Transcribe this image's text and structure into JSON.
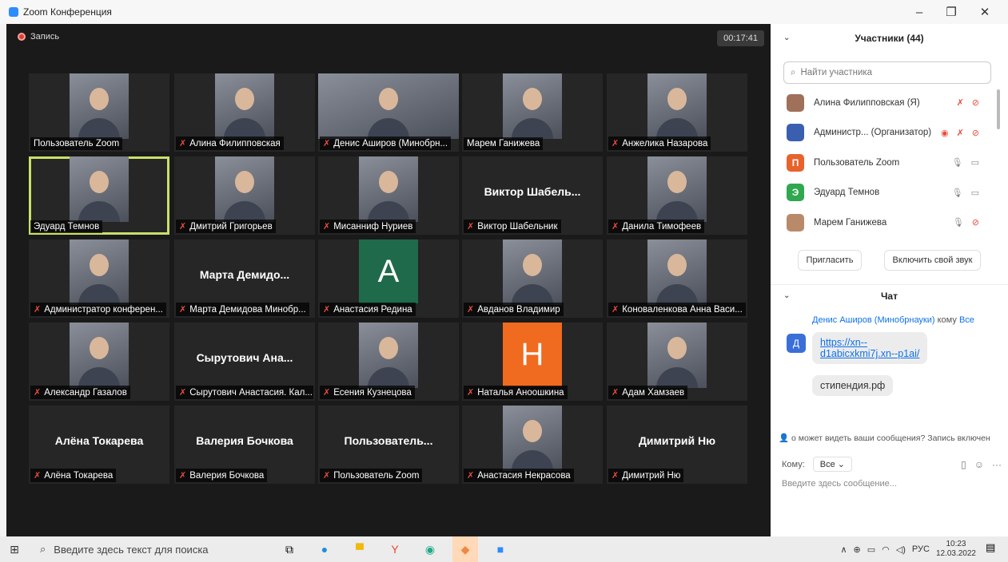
{
  "window": {
    "title": "Zoom Конференция",
    "minimize": "–",
    "restore": "❐",
    "close": "✕"
  },
  "meeting": {
    "recording_label": "Запись",
    "timer": "00:17:41"
  },
  "tiles": [
    {
      "label": "Пользователь Zoom",
      "muted": false,
      "kind": "photo"
    },
    {
      "label": "Алина Филипповская",
      "muted": true,
      "kind": "photo"
    },
    {
      "label": "Денис Аширов (Минобрн...",
      "muted": true,
      "kind": "photo-wide"
    },
    {
      "label": "Марем Ганижева",
      "muted": false,
      "kind": "photo"
    },
    {
      "label": "Анжелика Назарова",
      "muted": true,
      "kind": "photo"
    },
    {
      "label": "Эдуард Темнов",
      "muted": false,
      "kind": "photo",
      "active": true
    },
    {
      "label": "Дмитрий Григорьев",
      "muted": true,
      "kind": "photo"
    },
    {
      "label": "Мисанниф Нуриев",
      "muted": true,
      "kind": "photo"
    },
    {
      "label": "Виктор Шабельник",
      "muted": true,
      "kind": "name",
      "big": "Виктор Шабель..."
    },
    {
      "label": "Данила Тимофеев",
      "muted": true,
      "kind": "photo"
    },
    {
      "label": "Администратор конферен...",
      "muted": true,
      "kind": "photo"
    },
    {
      "label": "Марта Демидова Минобр...",
      "muted": true,
      "kind": "name",
      "big": "Марта Демидо..."
    },
    {
      "label": "Анастасия Редина",
      "muted": true,
      "kind": "letter",
      "letter": "A",
      "bg": "#1f6a4a"
    },
    {
      "label": "Авданов Владимир",
      "muted": true,
      "kind": "photo"
    },
    {
      "label": "Коноваленкова Анна Васи...",
      "muted": true,
      "kind": "photo"
    },
    {
      "label": "Александр Газалов",
      "muted": true,
      "kind": "photo"
    },
    {
      "label": "Сырутович Анастасия. Кал...",
      "muted": true,
      "kind": "name",
      "big": "Сырутович Ана..."
    },
    {
      "label": "Есения Кузнецова",
      "muted": true,
      "kind": "photo"
    },
    {
      "label": "Наталья Аноошкина",
      "muted": true,
      "kind": "letter",
      "letter": "H",
      "bg": "#f06a1f"
    },
    {
      "label": "Адам Хамзаев",
      "muted": true,
      "kind": "photo"
    },
    {
      "label": "Алёна Токарева",
      "muted": true,
      "kind": "name",
      "big": "Алёна Токарева"
    },
    {
      "label": "Валерия Бочкова",
      "muted": true,
      "kind": "name",
      "big": "Валерия Бочкова"
    },
    {
      "label": "Пользователь Zoom",
      "muted": true,
      "kind": "name",
      "big": "Пользователь..."
    },
    {
      "label": "Анастасия Некрасова",
      "muted": true,
      "kind": "photo"
    },
    {
      "label": "Димитрий Ню",
      "muted": true,
      "kind": "name",
      "big": "Димитрий Ню"
    }
  ],
  "participants_panel": {
    "title": "Участники (44)",
    "search_placeholder": "Найти участника",
    "items": [
      {
        "name": "Алина Филипповская (Я)",
        "avatar": "",
        "avatar_color": "#a0705a",
        "muted": true,
        "video_off": true
      },
      {
        "name": "Администр... (Организатор)",
        "avatar": "",
        "avatar_color": "#3a5fb0",
        "muted": true,
        "video_off": true,
        "recording": true
      },
      {
        "name": "Пользователь Zoom",
        "avatar": "П",
        "avatar_color": "#e8622c",
        "muted": false,
        "video_off": false
      },
      {
        "name": "Эдуард Темнов",
        "avatar": "Э",
        "avatar_color": "#2fa84f",
        "muted": false,
        "video_off": false
      },
      {
        "name": "Марем Ганижева",
        "avatar": "",
        "avatar_color": "#b98a6a",
        "muted": false,
        "video_off": true
      }
    ],
    "invite_button": "Пригласить",
    "unmute_button": "Включить свой звук"
  },
  "chat": {
    "title": "Чат",
    "from": "Денис Аширов (Минобрнауки)",
    "to_word": "кому",
    "to_target": "Все",
    "avatar": "Д",
    "link_line1": "https://xn--",
    "link_line2": "d1abicxkmi7j.xn--p1ai/",
    "message2": "стипендия.рф",
    "notice": "о может видеть ваши сообщения? Запись включен",
    "to_label": "Кому:",
    "to_select": "Все",
    "compose_placeholder": "Введите здесь сообщение..."
  },
  "taskbar": {
    "search_placeholder": "Введите здесь текст для поиска",
    "language": "РУС",
    "time": "10:23",
    "date": "12.03.2022",
    "notifications": "3"
  },
  "colors": {
    "accent": "#0e71eb",
    "mute_red": "#e94b3c",
    "active_speaker": "#c8e06a"
  }
}
